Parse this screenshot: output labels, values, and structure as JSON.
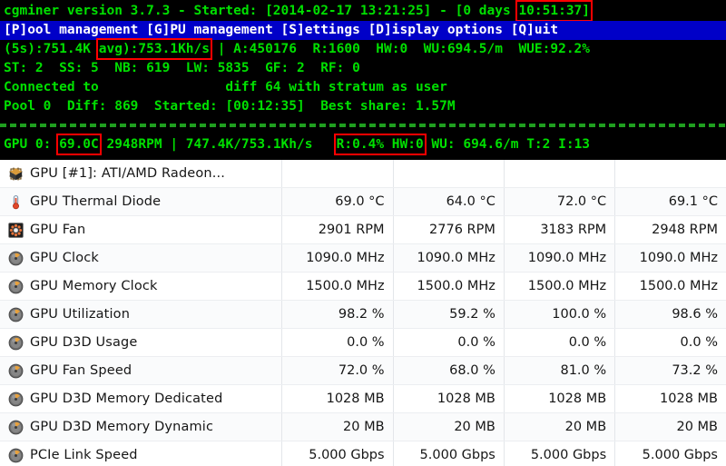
{
  "terminal": {
    "title_line": {
      "prefix": "cgminer version 3.7.3 - Started: [2014-02-17 13:21:25] - [0 days ",
      "highlight": "10:51:37]"
    },
    "menu_line": "[P]ool management [G]PU management [S]ettings [D]isplay options [Q]uit",
    "hashrate_line": {
      "pre": "(5s):751.4K ",
      "highlight": "avg):753.1Kh/s",
      "post": " | A:450176  R:1600  HW:0  WU:694.5/m  WUE:92.2%"
    },
    "stats_line": "ST: 2  SS: 5  NB: 619  LW: 5835  GF: 2  RF: 0",
    "connected_line": "Connected to                diff 64 with stratum as user",
    "pool_line": "Pool 0  Diff: 869  Started: [00:12:35]  Best share: 1.57M",
    "gpu_line": {
      "p1": "GPU 0: ",
      "hl1": "69.0C",
      "p2": " 2948RPM | 747.4K/753.1Kh/s   ",
      "hl2": "R:0.4% HW:0",
      "p3": " WU: 694.6/m T:2 I:13"
    },
    "colors": {
      "green": "#00e000",
      "menu_bg": "#0000c8",
      "menu_fg": "#ffffff",
      "highlight_box": "#ff0000",
      "background": "#000000"
    }
  },
  "table": {
    "rows": [
      {
        "icon": "gpu-chip-icon",
        "label": "GPU [#1]: ATI/AMD Radeon...",
        "values": [
          "",
          "",
          "",
          ""
        ]
      },
      {
        "icon": "thermometer-icon",
        "label": "GPU Thermal Diode",
        "values": [
          "69.0 °C",
          "64.0 °C",
          "72.0 °C",
          "69.1 °C"
        ]
      },
      {
        "icon": "fan-icon",
        "label": "GPU Fan",
        "values": [
          "2901 RPM",
          "2776 RPM",
          "3183 RPM",
          "2948 RPM"
        ]
      },
      {
        "icon": "gauge-icon",
        "label": "GPU Clock",
        "values": [
          "1090.0 MHz",
          "1090.0 MHz",
          "1090.0 MHz",
          "1090.0 MHz"
        ]
      },
      {
        "icon": "gauge-icon",
        "label": "GPU Memory Clock",
        "values": [
          "1500.0 MHz",
          "1500.0 MHz",
          "1500.0 MHz",
          "1500.0 MHz"
        ]
      },
      {
        "icon": "gauge-icon",
        "label": "GPU Utilization",
        "values": [
          "98.2 %",
          "59.2 %",
          "100.0 %",
          "98.6 %"
        ]
      },
      {
        "icon": "gauge-icon",
        "label": "GPU D3D Usage",
        "values": [
          "0.0 %",
          "0.0 %",
          "0.0 %",
          "0.0 %"
        ]
      },
      {
        "icon": "gauge-icon",
        "label": "GPU Fan Speed",
        "values": [
          "72.0 %",
          "68.0 %",
          "81.0 %",
          "73.2 %"
        ]
      },
      {
        "icon": "gauge-icon",
        "label": "GPU D3D Memory Dedicated",
        "values": [
          "1028 MB",
          "1028 MB",
          "1028 MB",
          "1028 MB"
        ]
      },
      {
        "icon": "gauge-icon",
        "label": "GPU D3D Memory Dynamic",
        "values": [
          "20 MB",
          "20 MB",
          "20 MB",
          "20 MB"
        ]
      },
      {
        "icon": "gauge-icon",
        "label": "PCIe Link Speed",
        "values": [
          "5.000 Gbps",
          "5.000 Gbps",
          "5.000 Gbps",
          "5.000 Gbps"
        ]
      }
    ]
  }
}
